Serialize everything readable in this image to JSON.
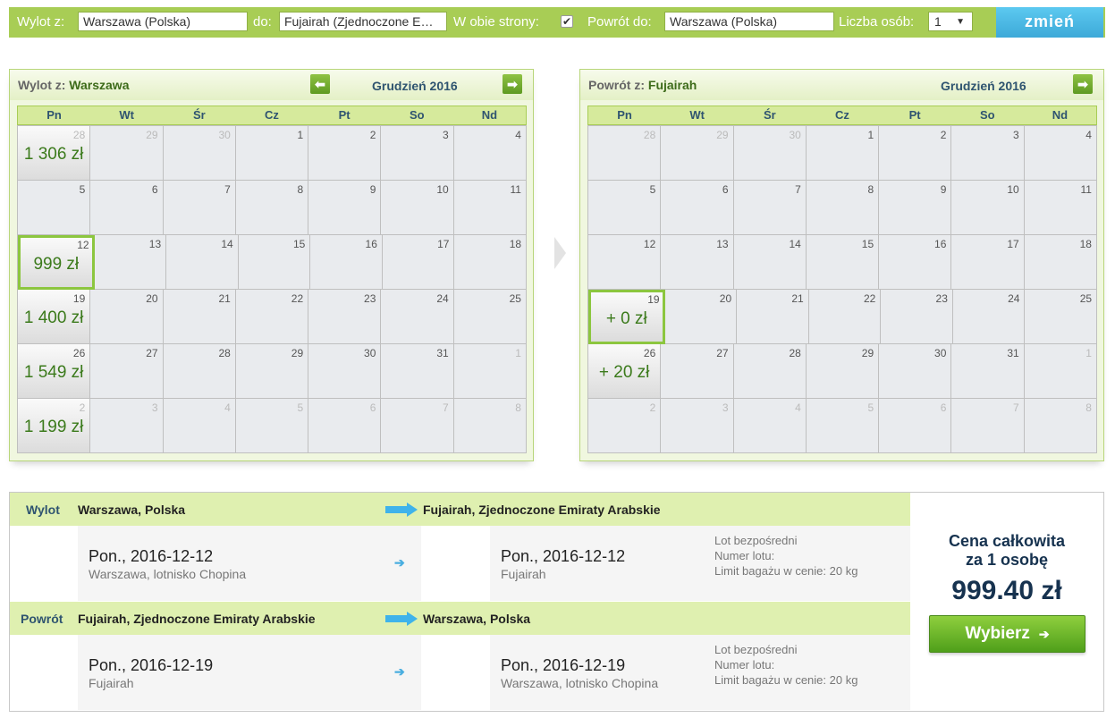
{
  "search": {
    "from_label": "Wylot z:",
    "from_value": "Warszawa (Polska)",
    "to_label": "do:",
    "to_value": "Fujairah (Zjednoczone Em…",
    "roundtrip_label": "W obie strony:",
    "roundtrip_check": "✔",
    "return_label": "Powrót do:",
    "return_value": "Warszawa (Polska)",
    "persons_label": "Liczba osób:",
    "persons_value": "1",
    "change_button": "zmień"
  },
  "outbound_calendar": {
    "title_prefix": "Wylot z:",
    "title_city": "Warszawa",
    "month": "Grudzień 2016",
    "weekdays": [
      "Pn",
      "Wt",
      "Śr",
      "Cz",
      "Pt",
      "So",
      "Nd"
    ],
    "weeks": [
      [
        {
          "d": "28",
          "o": true,
          "p": "1 306 zł"
        },
        {
          "d": "29",
          "o": true
        },
        {
          "d": "30",
          "o": true
        },
        {
          "d": "1"
        },
        {
          "d": "2"
        },
        {
          "d": "3"
        },
        {
          "d": "4"
        }
      ],
      [
        {
          "d": "5"
        },
        {
          "d": "6"
        },
        {
          "d": "7"
        },
        {
          "d": "8"
        },
        {
          "d": "9"
        },
        {
          "d": "10"
        },
        {
          "d": "11"
        }
      ],
      [
        {
          "d": "12",
          "p": "999 zł",
          "s": true
        },
        {
          "d": "13"
        },
        {
          "d": "14"
        },
        {
          "d": "15"
        },
        {
          "d": "16"
        },
        {
          "d": "17"
        },
        {
          "d": "18"
        }
      ],
      [
        {
          "d": "19",
          "p": "1 400 zł"
        },
        {
          "d": "20"
        },
        {
          "d": "21"
        },
        {
          "d": "22"
        },
        {
          "d": "23"
        },
        {
          "d": "24"
        },
        {
          "d": "25"
        }
      ],
      [
        {
          "d": "26",
          "p": "1 549 zł"
        },
        {
          "d": "27"
        },
        {
          "d": "28"
        },
        {
          "d": "29"
        },
        {
          "d": "30"
        },
        {
          "d": "31"
        },
        {
          "d": "1",
          "o": true
        }
      ],
      [
        {
          "d": "2",
          "o": true,
          "p": "1 199 zł"
        },
        {
          "d": "3",
          "o": true
        },
        {
          "d": "4",
          "o": true
        },
        {
          "d": "5",
          "o": true
        },
        {
          "d": "6",
          "o": true
        },
        {
          "d": "7",
          "o": true
        },
        {
          "d": "8",
          "o": true
        }
      ]
    ]
  },
  "return_calendar": {
    "title_prefix": "Powrót z:",
    "title_city": "Fujairah",
    "month": "Grudzień 2016",
    "weekdays": [
      "Pn",
      "Wt",
      "Śr",
      "Cz",
      "Pt",
      "So",
      "Nd"
    ],
    "weeks": [
      [
        {
          "d": "28",
          "o": true
        },
        {
          "d": "29",
          "o": true
        },
        {
          "d": "30",
          "o": true
        },
        {
          "d": "1"
        },
        {
          "d": "2"
        },
        {
          "d": "3"
        },
        {
          "d": "4"
        }
      ],
      [
        {
          "d": "5"
        },
        {
          "d": "6"
        },
        {
          "d": "7"
        },
        {
          "d": "8"
        },
        {
          "d": "9"
        },
        {
          "d": "10"
        },
        {
          "d": "11"
        }
      ],
      [
        {
          "d": "12"
        },
        {
          "d": "13"
        },
        {
          "d": "14"
        },
        {
          "d": "15"
        },
        {
          "d": "16"
        },
        {
          "d": "17"
        },
        {
          "d": "18"
        }
      ],
      [
        {
          "d": "19",
          "p": "+ 0 zł",
          "s": true
        },
        {
          "d": "20"
        },
        {
          "d": "21"
        },
        {
          "d": "22"
        },
        {
          "d": "23"
        },
        {
          "d": "24"
        },
        {
          "d": "25"
        }
      ],
      [
        {
          "d": "26",
          "p": "+ 20 zł"
        },
        {
          "d": "27"
        },
        {
          "d": "28"
        },
        {
          "d": "29"
        },
        {
          "d": "30"
        },
        {
          "d": "31"
        },
        {
          "d": "1",
          "o": true
        }
      ],
      [
        {
          "d": "2",
          "o": true
        },
        {
          "d": "3",
          "o": true
        },
        {
          "d": "4",
          "o": true
        },
        {
          "d": "5",
          "o": true
        },
        {
          "d": "6",
          "o": true
        },
        {
          "d": "7",
          "o": true
        },
        {
          "d": "8",
          "o": true
        }
      ]
    ]
  },
  "summary": {
    "outbound": {
      "label": "Wylot",
      "from_city": "Warszawa, Polska",
      "to_city": "Fujairah, Zjednoczone Emiraty Arabskie",
      "dep_date": "Pon., 2016-12-12",
      "dep_airport": "Warszawa, lotnisko Chopina",
      "arr_date": "Pon., 2016-12-12",
      "arr_airport": "Fujairah",
      "info1": "Lot bezpośredni",
      "info2": "Numer lotu:",
      "info3": "Limit bagażu w cenie: 20 kg"
    },
    "return": {
      "label": "Powrót",
      "from_city": "Fujairah, Zjednoczone Emiraty Arabskie",
      "to_city": "Warszawa, Polska",
      "dep_date": "Pon., 2016-12-19",
      "dep_airport": "Fujairah",
      "arr_date": "Pon., 2016-12-19",
      "arr_airport": "Warszawa, lotnisko Chopina",
      "info1": "Lot bezpośredni",
      "info2": "Numer lotu:",
      "info3": "Limit bagażu w cenie: 20 kg"
    },
    "total_label_1": "Cena całkowita",
    "total_label_2": "za 1 osobę",
    "total_price": "999.40 zł",
    "select_button": "Wybierz",
    "arrow_glyph": "➔"
  },
  "colors": {
    "accent_green": "#a8cd55",
    "price_green": "#3b7a1b",
    "navy": "#16324f",
    "blue_button": "#3da9d8"
  }
}
